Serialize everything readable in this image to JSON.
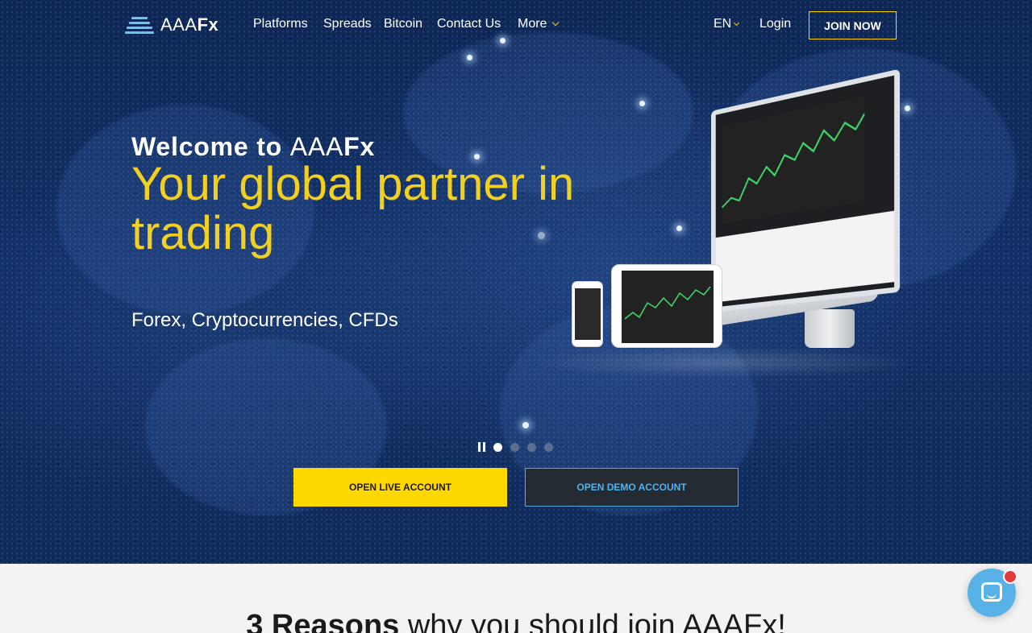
{
  "brand": {
    "logo_prefix": "AAA",
    "logo_suffix": "Fx"
  },
  "nav": {
    "items": [
      "Platforms",
      "Spreads",
      "Bitcoin",
      "Contact Us",
      "More"
    ],
    "language": "EN",
    "login": "Login",
    "join": "JOIN NOW"
  },
  "hero": {
    "welcome_prefix": "Welcome to ",
    "welcome_brand_a": "AAA",
    "welcome_brand_b": "Fx",
    "tagline": "Your global partner in trading",
    "subline": "Forex, Cryptocurrencies, CFDs",
    "slides": {
      "count": 4,
      "active": 1
    }
  },
  "cta": {
    "live": "OPEN LIVE ACCOUNT",
    "demo": "OPEN DEMO ACCOUNT"
  },
  "reasons": {
    "title_bold": "3 Reasons",
    "title_rest": " why you should join AAAFx!"
  },
  "icons": {
    "logo": "stacked-bars-logo-icon",
    "chat": "chat-bubble-icon",
    "pause": "pause-icon"
  },
  "colors": {
    "accent_yellow": "#ffd800",
    "tagline_yellow": "#f2d022",
    "demo_blue": "#4eb4f0",
    "hero_navy": "#123066"
  }
}
